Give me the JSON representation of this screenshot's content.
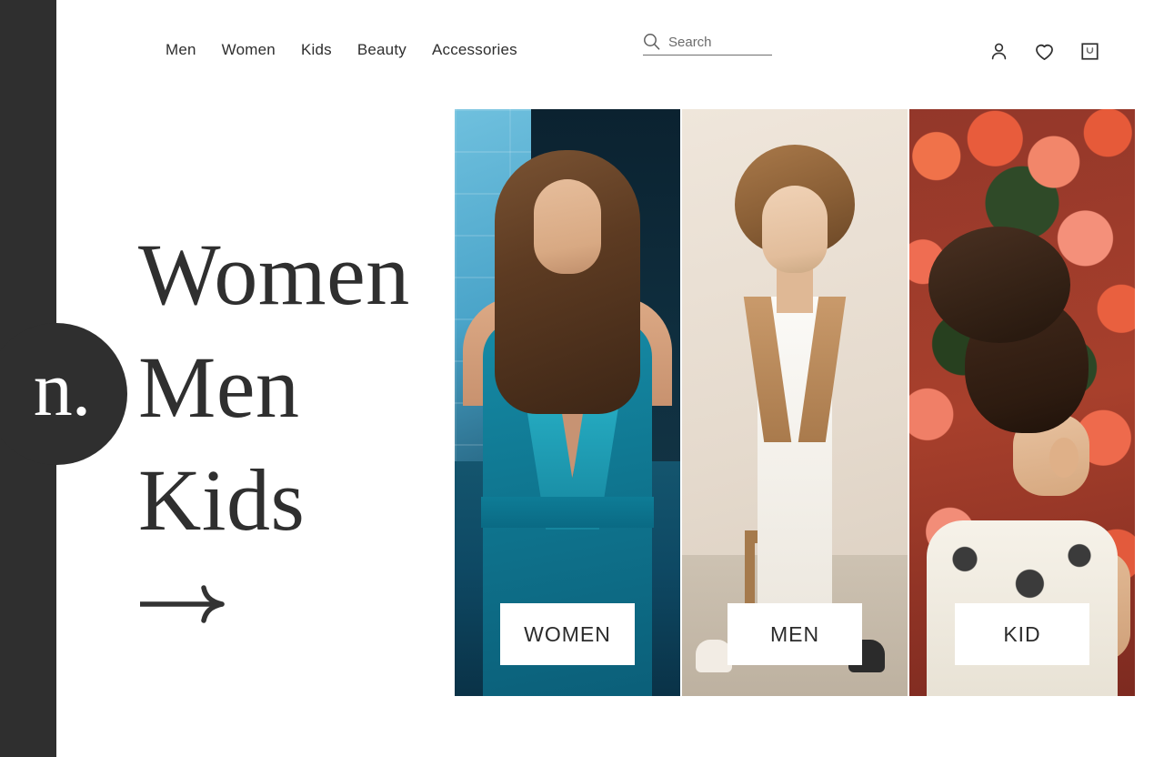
{
  "brand": {
    "badge_text": "n."
  },
  "header": {
    "nav": [
      {
        "label": "Men",
        "name": "nav-link-men"
      },
      {
        "label": "Women",
        "name": "nav-link-women"
      },
      {
        "label": "Kids",
        "name": "nav-link-kids"
      },
      {
        "label": "Beauty",
        "name": "nav-link-beauty"
      },
      {
        "label": "Accessories",
        "name": "nav-link-accessories"
      }
    ],
    "search": {
      "placeholder": "Search",
      "value": "",
      "icon": "search-icon"
    },
    "icons": [
      {
        "name": "account-icon",
        "label": "Account"
      },
      {
        "name": "wishlist-heart-icon",
        "label": "Wishlist"
      },
      {
        "name": "shopping-bag-icon",
        "label": "Bag"
      }
    ]
  },
  "hero": {
    "lines": [
      {
        "label": "Women"
      },
      {
        "label": "Men"
      },
      {
        "label": "Kids"
      }
    ],
    "cta_icon": "arrow-right-icon"
  },
  "cards": [
    {
      "label": "WOMEN",
      "name": "category-card-women",
      "photo": "woman-in-teal-jumpsuit"
    },
    {
      "label": "MEN",
      "name": "category-card-men",
      "photo": "man-in-camel-blazer-on-stool"
    },
    {
      "label": "KID",
      "name": "category-card-kid",
      "photo": "child-with-hair-bun-by-flowers"
    }
  ],
  "colors": {
    "rail": "#2f2f2f",
    "text": "#2f2f2f",
    "page_background": "#ffffff",
    "label_background": "#ffffff",
    "search_underline": "#6f6f6f"
  }
}
